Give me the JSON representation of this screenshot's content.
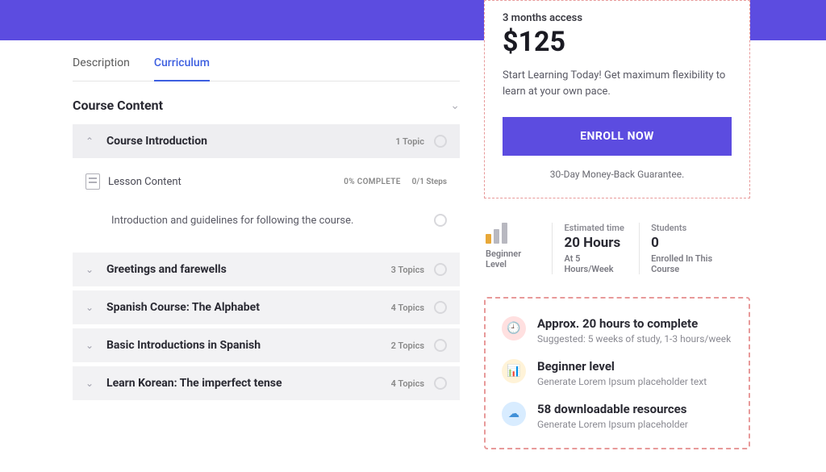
{
  "tabs": {
    "description": "Description",
    "curriculum": "Curriculum"
  },
  "content_title": "Course Content",
  "sections": [
    {
      "title": "Course Introduction",
      "meta": "1 Topic",
      "expanded": true
    },
    {
      "title": "Greetings and farewells",
      "meta": "3 Topics",
      "expanded": false
    },
    {
      "title": "Spanish Course: The Alphabet",
      "meta": "4 Topics",
      "expanded": false
    },
    {
      "title": "Basic Introductions in Spanish",
      "meta": "2 Topics",
      "expanded": false
    },
    {
      "title": "Learn Korean: The imperfect tense",
      "meta": "4 Topics",
      "expanded": false
    }
  ],
  "lesson": {
    "title": "Lesson Content",
    "progress": "0% COMPLETE",
    "steps": "0/1 Steps",
    "desc": "Introduction and guidelines for following the course."
  },
  "price_card": {
    "term": "3 months access",
    "price": "$125",
    "start": "Start Learning Today! Get maximum flexibility to learn at your own pace.",
    "enroll": "ENROLL NOW",
    "guarantee": "30-Day Money-Back Guarantee."
  },
  "stats": {
    "level": "Beginner Level",
    "est_label": "Estimated time",
    "est_value": "20 Hours",
    "est_sub": "At 5 Hours/Week",
    "students_label": "Students",
    "students_value": "0",
    "students_sub": "Enrolled In This Course"
  },
  "highlights": [
    {
      "title": "Approx. 20 hours to complete",
      "sub": "Suggested: 5 weeks of study, 1-3 hours/week",
      "icon": "clock",
      "tone": "red"
    },
    {
      "title": "Beginner level",
      "sub": "Generate Lorem Ipsum placeholder text",
      "icon": "level",
      "tone": "yel"
    },
    {
      "title": "58 downloadable resources",
      "sub": "Generate Lorem Ipsum placeholder",
      "icon": "download",
      "tone": "blu"
    }
  ]
}
